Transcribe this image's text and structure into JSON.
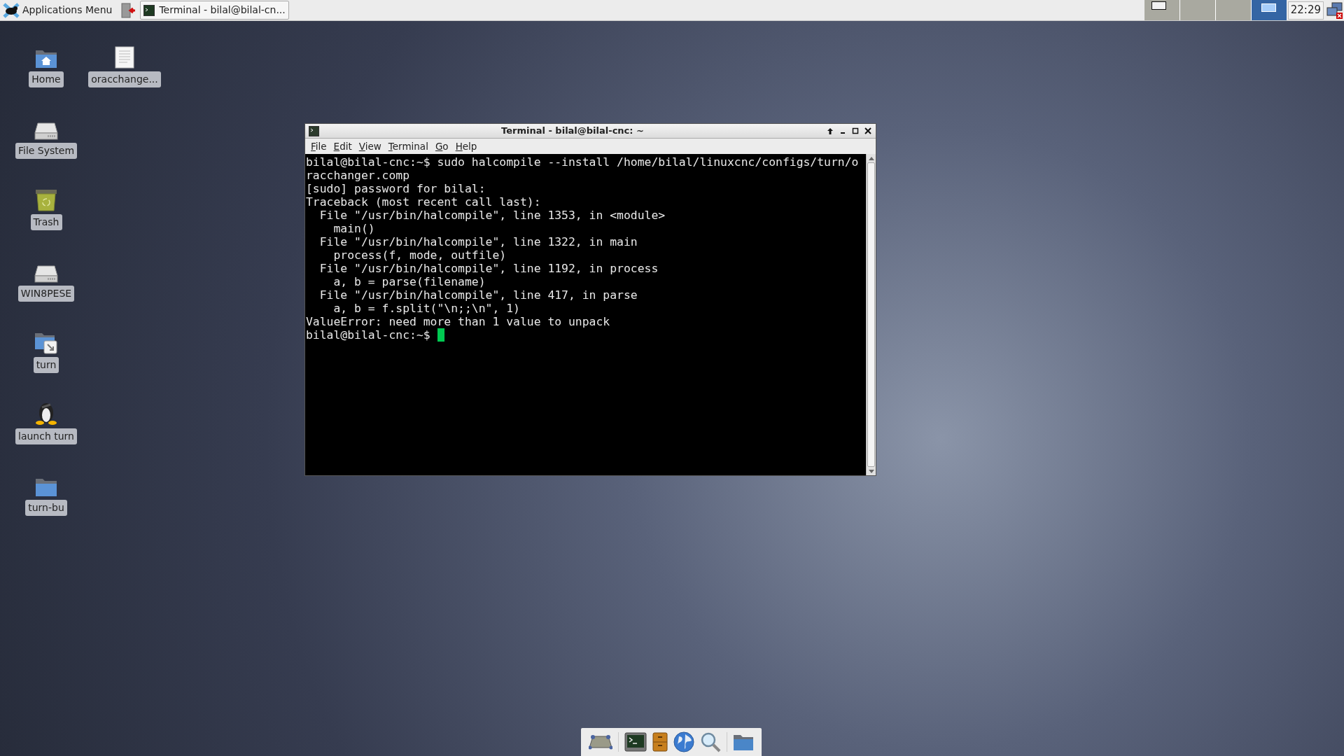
{
  "panel": {
    "apps_menu": "Applications Menu",
    "tasks": [
      {
        "label": "Terminal - bilal@bilal-cn...",
        "selected": true
      }
    ],
    "workspaces": [
      {
        "selected": false,
        "has_window": true
      },
      {
        "selected": false,
        "has_window": false
      },
      {
        "selected": false,
        "has_window": false
      },
      {
        "selected": true,
        "has_window": true
      }
    ],
    "clock": "22:29"
  },
  "desktop": {
    "columns": [
      [
        {
          "label": "Home",
          "kind": "home"
        },
        {
          "label": "File System",
          "kind": "drive"
        },
        {
          "label": "Trash",
          "kind": "trash"
        },
        {
          "label": "WIN8PESE",
          "kind": "drive"
        },
        {
          "label": "turn",
          "kind": "link"
        },
        {
          "label": "launch turn",
          "kind": "penguin"
        },
        {
          "label": "turn-bu",
          "kind": "folder"
        }
      ],
      [
        {
          "label": "oracchange...",
          "kind": "document"
        }
      ]
    ]
  },
  "terminal": {
    "title": "Terminal - bilal@bilal-cnc: ~",
    "menu": [
      "File",
      "Edit",
      "View",
      "Terminal",
      "Go",
      "Help"
    ],
    "lines": [
      "bilal@bilal-cnc:~$ sudo halcompile --install /home/bilal/linuxcnc/configs/turn/o",
      "racchanger.comp",
      "[sudo] password for bilal:",
      "Traceback (most recent call last):",
      "  File \"/usr/bin/halcompile\", line 1353, in <module>",
      "    main()",
      "  File \"/usr/bin/halcompile\", line 1322, in main",
      "    process(f, mode, outfile)",
      "  File \"/usr/bin/halcompile\", line 1192, in process",
      "    a, b = parse(filename)",
      "  File \"/usr/bin/halcompile\", line 417, in parse",
      "    a, b = f.split(\"\\n;;\\n\", 1)",
      "ValueError: need more than 1 value to unpack"
    ],
    "prompt": "bilal@bilal-cnc:~$ "
  }
}
